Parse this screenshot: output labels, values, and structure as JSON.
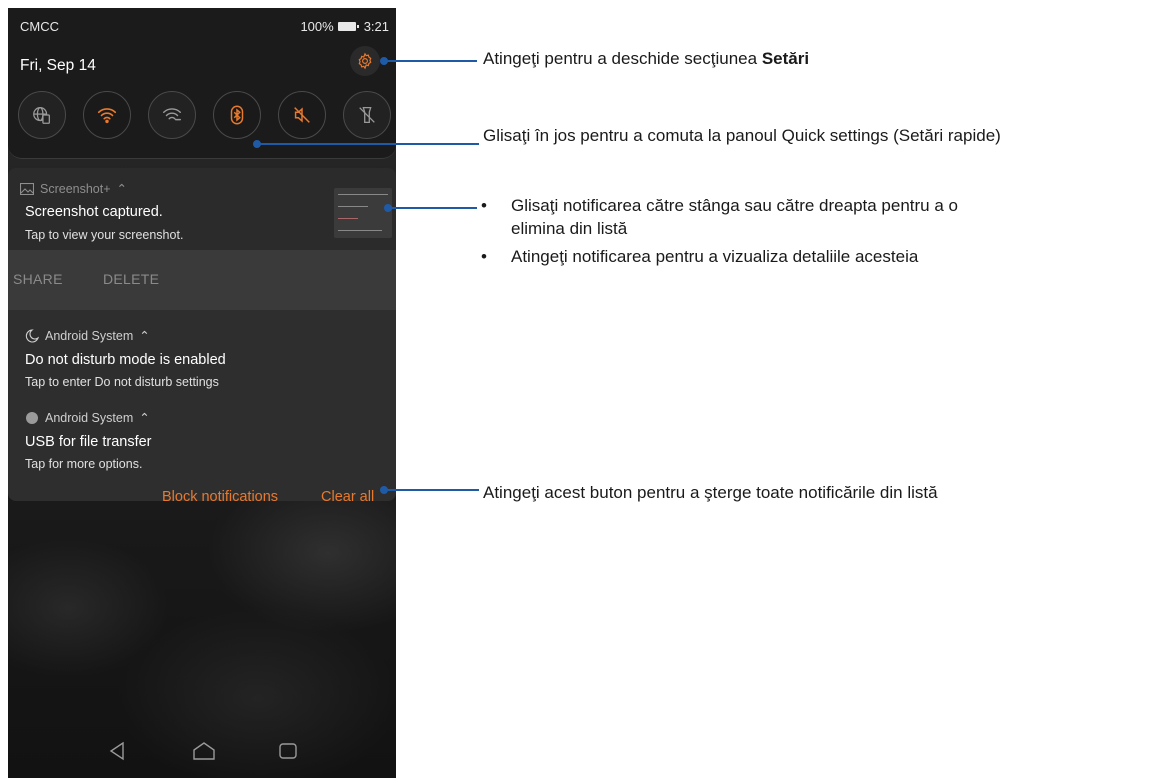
{
  "status_bar": {
    "carrier": "CMCC",
    "battery": "100%",
    "time": "3:21"
  },
  "quick_settings": {
    "date": "Fri, Sep 14",
    "tiles": [
      {
        "icon": "globe-sim-icon",
        "active": false
      },
      {
        "icon": "wifi-icon",
        "active": true
      },
      {
        "icon": "wifi-off-icon",
        "active": false
      },
      {
        "icon": "bluetooth-icon",
        "active": true
      },
      {
        "icon": "mute-icon",
        "active": true
      },
      {
        "icon": "flashlight-icon",
        "active": false
      }
    ]
  },
  "notifications": [
    {
      "app": "Screenshot+",
      "title": "Screenshot captured.",
      "text": "Tap to view your screenshot.",
      "actions": [
        "SHARE",
        "DELETE"
      ]
    },
    {
      "app": "Android System",
      "title": "Do not disturb mode is enabled",
      "text": "Tap to enter Do not disturb settings"
    },
    {
      "app": "Android System",
      "title": "USB for file transfer",
      "text": "Tap for more options."
    }
  ],
  "footer_buttons": {
    "block": "Block notifications",
    "clear": "Clear all"
  },
  "callouts": {
    "settings_prefix": "Atingeţi pentru a deschide secţiunea ",
    "settings_bold": "Setări",
    "swipe_down": "Glisaţi în jos pentru a comuta la panoul Quick settings (Setări rapide)",
    "bullet_mark": "•",
    "bullet1_line1": "Glisaţi notificarea către stânga sau către dreapta pentru a o",
    "bullet1_line2": "elimina din listă",
    "bullet2": "Atingeţi notificarea pentru a vizualiza detaliile acesteia",
    "clear_all": "Atingeţi acest buton pentru a şterge toate notificările din listă"
  },
  "colors": {
    "accent": "#e8792d",
    "annotation": "#1f5aa6"
  }
}
